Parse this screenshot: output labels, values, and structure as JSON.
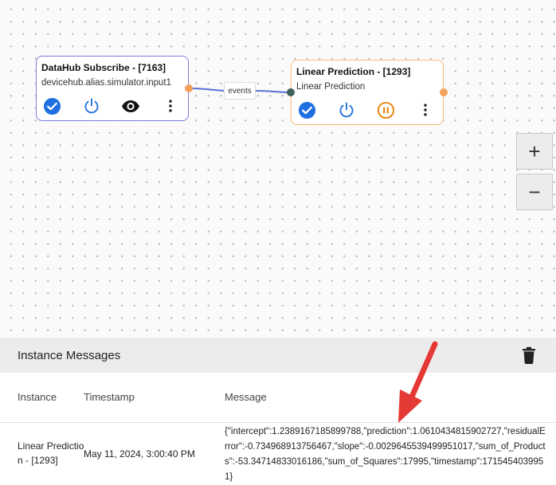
{
  "flow": {
    "nodes": [
      {
        "title": "DataHub Subscribe - [7163]",
        "subtitle": "devicehub.alias.simulator.input1"
      },
      {
        "title": "Linear Prediction - [1293]",
        "subtitle": "Linear Prediction"
      }
    ],
    "edge_label": "events"
  },
  "zoom": {
    "in_label": "+",
    "out_label": "−"
  },
  "messages": {
    "title": "Instance Messages",
    "columns": [
      "Instance",
      "Timestamp",
      "Message"
    ],
    "rows": [
      {
        "instance": "Linear Prediction - [1293]",
        "timestamp": "May 11, 2024, 3:00:40 PM",
        "message": "{\"intercept\":1.2389167185899788,\"prediction\":1.0610434815902727,\"residualError\":-0.734968913756467,\"slope\":-0.0029645539499951017,\"sum_of_Products\":-53.34714833016186,\"sum_of_Squares\":17995,\"timestamp\":1715454039951}"
      }
    ]
  },
  "colors": {
    "primary": "#1e6fe0",
    "pause": "#e8840c",
    "annotation": "#e53935"
  }
}
